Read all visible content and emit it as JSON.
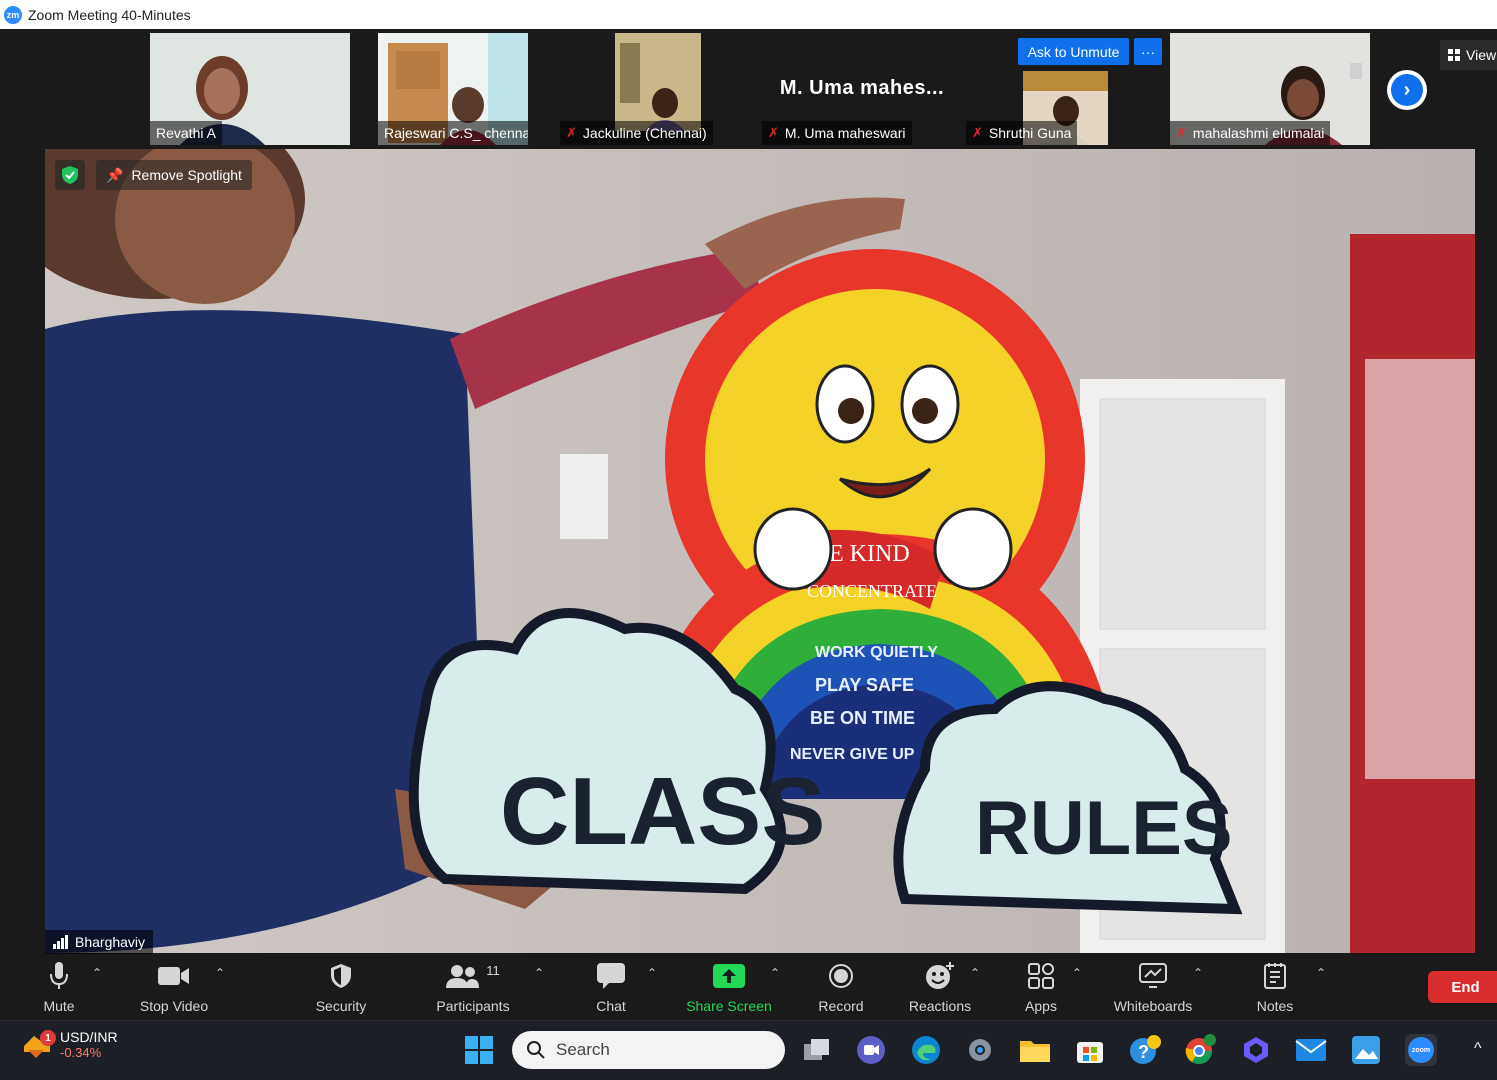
{
  "window": {
    "title": "Zoom Meeting 40-Minutes",
    "logo_text": "zm"
  },
  "participants_strip": [
    {
      "name": "Revathi A",
      "muted": false
    },
    {
      "name": "Rajeswari C.S_ chennai",
      "muted": false
    },
    {
      "name": "Jackuline (Chennai)",
      "muted": true
    },
    {
      "name": "M. Uma maheswari",
      "muted": true,
      "display_text": "M.  Uma  mahes..."
    },
    {
      "name": "Shruthi Guna",
      "muted": true
    },
    {
      "name": "mahalashmi elumalai",
      "muted": true
    }
  ],
  "strip_actions": {
    "ask_unmute": "Ask to Unmute",
    "more": "···",
    "view": "View"
  },
  "main": {
    "spotlight_label": "Remove Spotlight",
    "speaker_name": "Bharghaviy",
    "poster": {
      "board_words_left": "CLASS",
      "board_words_right": "RULES",
      "banner_1": "BE KIND",
      "banner_2": "CONCENTRATE",
      "rainbow_1": "WORK QUIETLY",
      "rainbow_2": "PLAY SAFE",
      "rainbow_3": "BE ON TIME",
      "rainbow_4": "NEVER GIVE UP"
    }
  },
  "toolbar": {
    "mute": "Mute",
    "stop_video": "Stop Video",
    "security": "Security",
    "participants": "Participants",
    "participants_count": "11",
    "chat": "Chat",
    "share_screen": "Share Screen",
    "record": "Record",
    "reactions": "Reactions",
    "apps": "Apps",
    "whiteboards": "Whiteboards",
    "notes": "Notes",
    "end": "End"
  },
  "taskbar": {
    "ticker_symbol": "USD/INR",
    "ticker_change": "-0.34%",
    "ticker_badge": "1",
    "search_placeholder": "Search",
    "zoom_icon_text": "zoom"
  },
  "colors": {
    "accent": "#0e71eb",
    "end_red": "#d92c2c",
    "share_green": "#23d959"
  }
}
